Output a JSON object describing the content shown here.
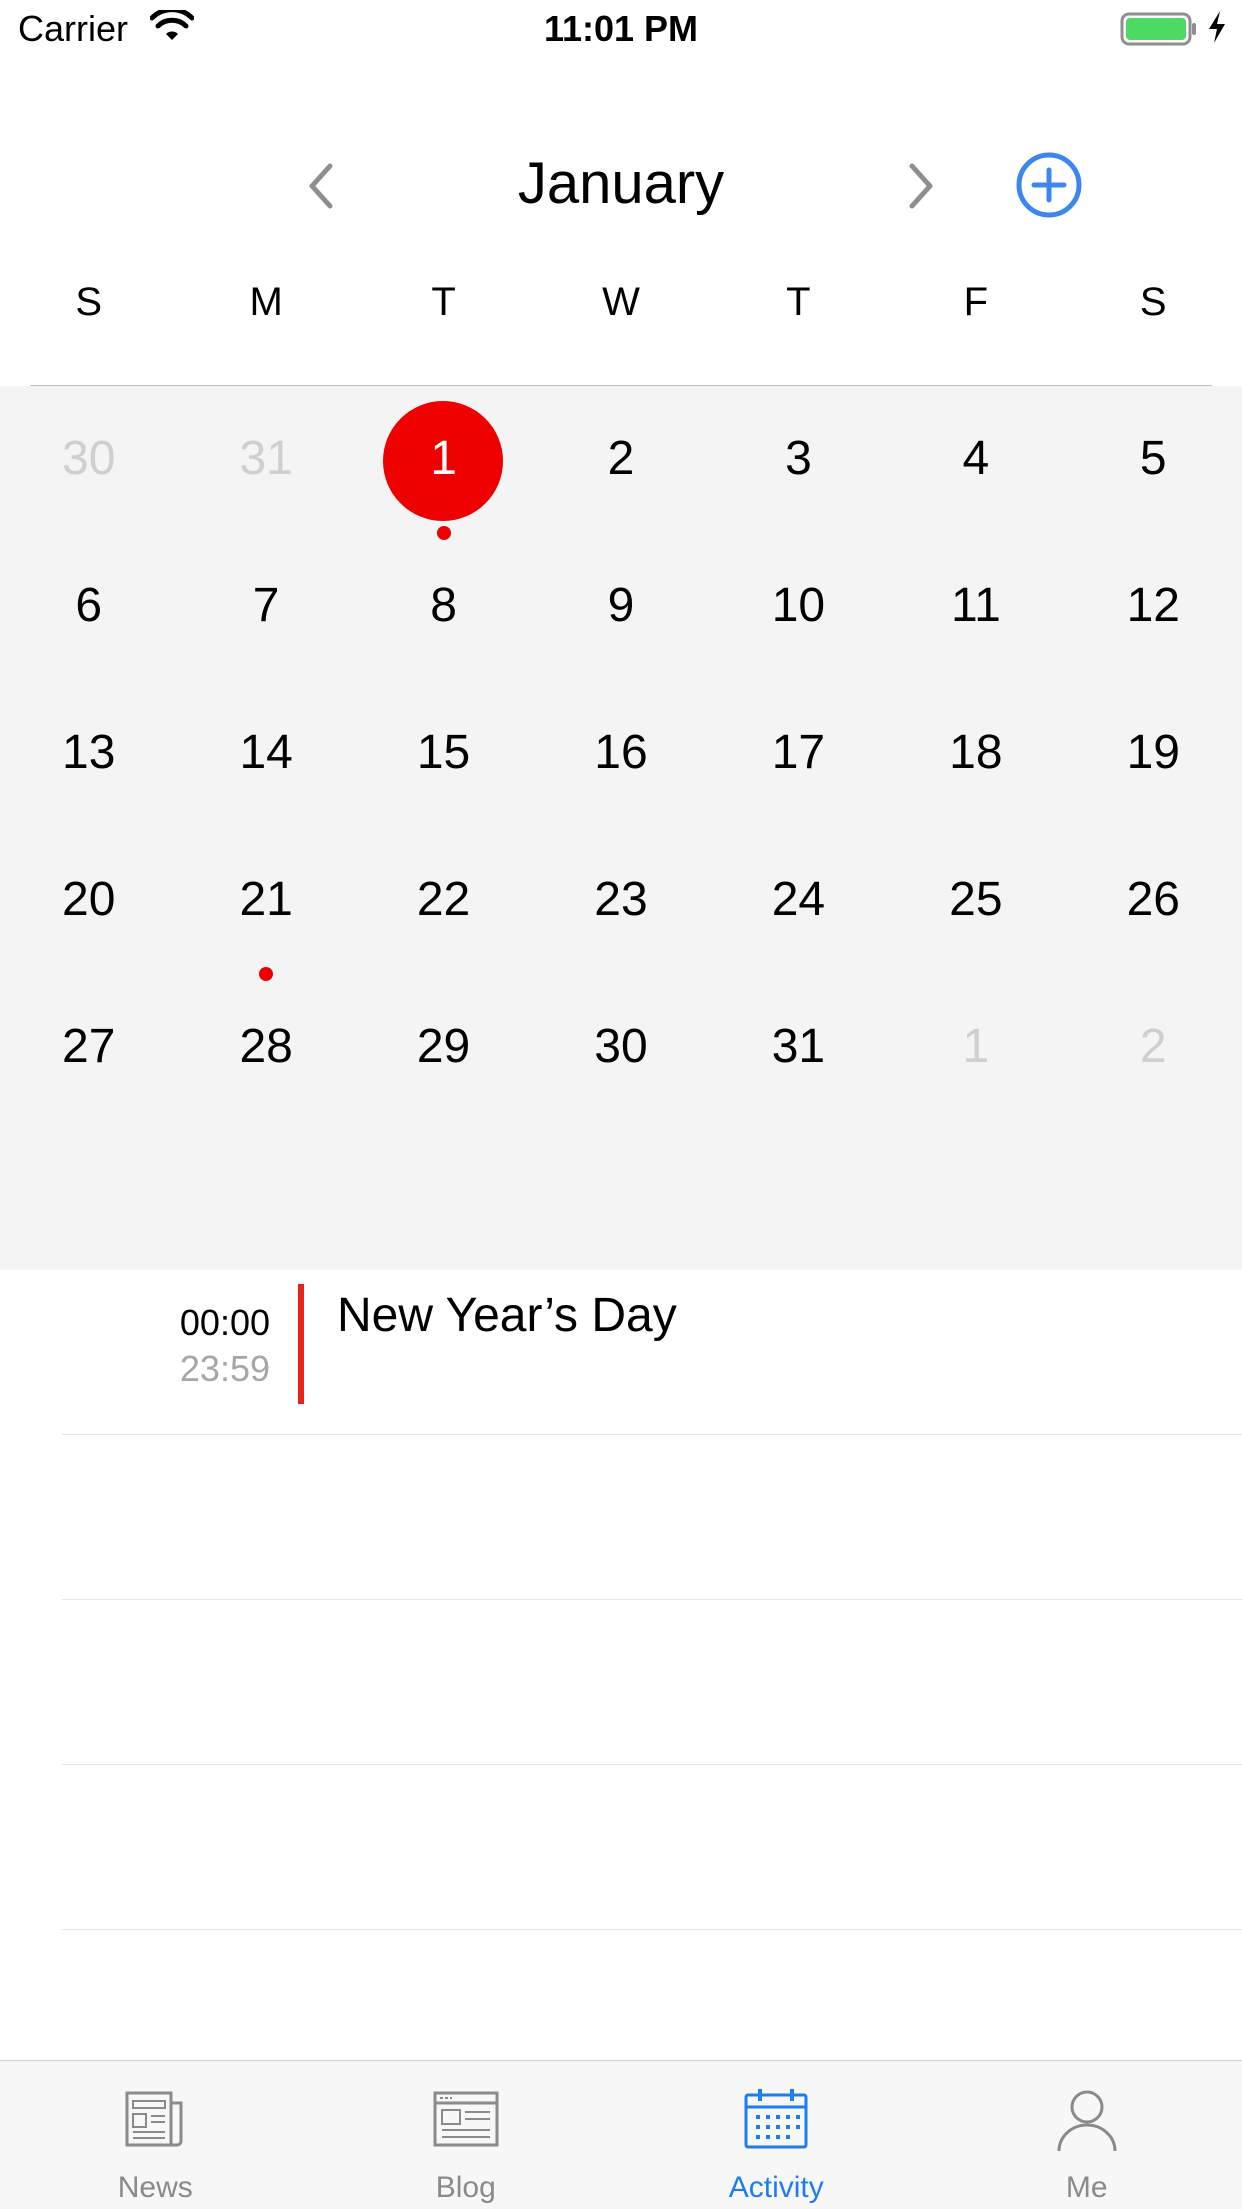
{
  "status_bar": {
    "carrier": "Carrier",
    "time": "11:01 PM",
    "battery_color": "#4cd964"
  },
  "header": {
    "month": "January",
    "prev_icon": "chevron-left-icon",
    "next_icon": "chevron-right-icon",
    "add_icon": "plus-circle-icon",
    "accent_color": "#3d86ec"
  },
  "weekdays": [
    "S",
    "M",
    "T",
    "W",
    "T",
    "F",
    "S"
  ],
  "calendar": {
    "selected_color": "#ee0000",
    "weeks": [
      [
        {
          "day": "30",
          "other": true
        },
        {
          "day": "31",
          "other": true
        },
        {
          "day": "1",
          "selected": true,
          "event": true
        },
        {
          "day": "2"
        },
        {
          "day": "3"
        },
        {
          "day": "4"
        },
        {
          "day": "5"
        }
      ],
      [
        {
          "day": "6"
        },
        {
          "day": "7"
        },
        {
          "day": "8"
        },
        {
          "day": "9"
        },
        {
          "day": "10"
        },
        {
          "day": "11"
        },
        {
          "day": "12"
        }
      ],
      [
        {
          "day": "13"
        },
        {
          "day": "14"
        },
        {
          "day": "15"
        },
        {
          "day": "16"
        },
        {
          "day": "17"
        },
        {
          "day": "18"
        },
        {
          "day": "19"
        }
      ],
      [
        {
          "day": "20"
        },
        {
          "day": "21",
          "event": true
        },
        {
          "day": "22"
        },
        {
          "day": "23"
        },
        {
          "day": "24"
        },
        {
          "day": "25"
        },
        {
          "day": "26"
        }
      ],
      [
        {
          "day": "27"
        },
        {
          "day": "28"
        },
        {
          "day": "29"
        },
        {
          "day": "30"
        },
        {
          "day": "31"
        },
        {
          "day": "1",
          "other": true
        },
        {
          "day": "2",
          "other": true
        }
      ]
    ]
  },
  "events": [
    {
      "start": "00:00",
      "end": "23:59",
      "title": "New Year’s Day",
      "color": "#e8231c"
    }
  ],
  "tab_bar": {
    "active_color": "#1e7cf2",
    "tabs": [
      {
        "label": "News",
        "icon": "newspaper-icon",
        "active": false
      },
      {
        "label": "Blog",
        "icon": "blog-icon",
        "active": false
      },
      {
        "label": "Activity",
        "icon": "calendar-icon",
        "active": true
      },
      {
        "label": "Me",
        "icon": "person-icon",
        "active": false
      }
    ]
  }
}
